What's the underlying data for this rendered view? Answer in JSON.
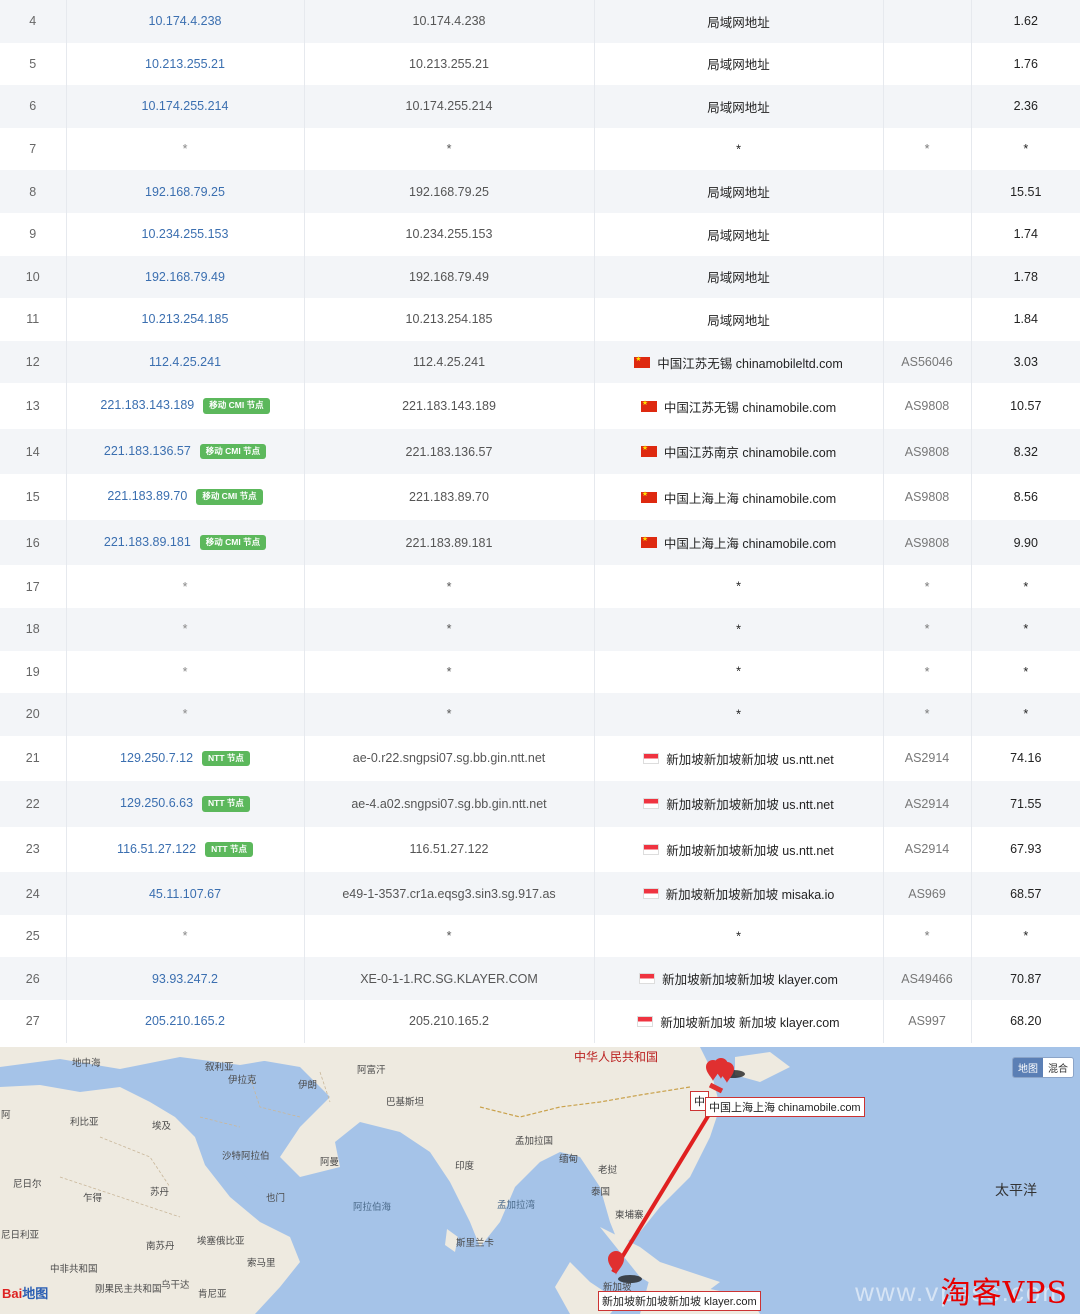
{
  "table": {
    "rows": [
      {
        "hop": "4",
        "ip": "10.174.4.238",
        "badge": "",
        "host": "10.174.4.238",
        "flag": "",
        "geo": "局域网地址",
        "asn": "",
        "rtt": "1.62"
      },
      {
        "hop": "5",
        "ip": "10.213.255.21",
        "badge": "",
        "host": "10.213.255.21",
        "flag": "",
        "geo": "局域网地址",
        "asn": "",
        "rtt": "1.76"
      },
      {
        "hop": "6",
        "ip": "10.174.255.214",
        "badge": "",
        "host": "10.174.255.214",
        "flag": "",
        "geo": "局域网地址",
        "asn": "",
        "rtt": "2.36"
      },
      {
        "hop": "7",
        "ip": "*",
        "badge": "",
        "host": "*",
        "flag": "",
        "geo": "*",
        "asn": "*",
        "rtt": "*"
      },
      {
        "hop": "8",
        "ip": "192.168.79.25",
        "badge": "",
        "host": "192.168.79.25",
        "flag": "",
        "geo": "局域网地址",
        "asn": "",
        "rtt": "15.51"
      },
      {
        "hop": "9",
        "ip": "10.234.255.153",
        "badge": "",
        "host": "10.234.255.153",
        "flag": "",
        "geo": "局域网地址",
        "asn": "",
        "rtt": "1.74"
      },
      {
        "hop": "10",
        "ip": "192.168.79.49",
        "badge": "",
        "host": "192.168.79.49",
        "flag": "",
        "geo": "局域网地址",
        "asn": "",
        "rtt": "1.78"
      },
      {
        "hop": "11",
        "ip": "10.213.254.185",
        "badge": "",
        "host": "10.213.254.185",
        "flag": "",
        "geo": "局域网地址",
        "asn": "",
        "rtt": "1.84"
      },
      {
        "hop": "12",
        "ip": "112.4.25.241",
        "badge": "",
        "host": "112.4.25.241",
        "flag": "cn",
        "geo": "中国江苏无锡 chinamobileltd.com",
        "asn": "AS56046",
        "rtt": "3.03"
      },
      {
        "hop": "13",
        "ip": "221.183.143.189",
        "badge": "移动 CMI 节点",
        "host": "221.183.143.189",
        "flag": "cn",
        "geo": "中国江苏无锡 chinamobile.com",
        "asn": "AS9808",
        "rtt": "10.57"
      },
      {
        "hop": "14",
        "ip": "221.183.136.57",
        "badge": "移动 CMI 节点",
        "host": "221.183.136.57",
        "flag": "cn",
        "geo": "中国江苏南京 chinamobile.com",
        "asn": "AS9808",
        "rtt": "8.32"
      },
      {
        "hop": "15",
        "ip": "221.183.89.70",
        "badge": "移动 CMI 节点",
        "host": "221.183.89.70",
        "flag": "cn",
        "geo": "中国上海上海 chinamobile.com",
        "asn": "AS9808",
        "rtt": "8.56"
      },
      {
        "hop": "16",
        "ip": "221.183.89.181",
        "badge": "移动 CMI 节点",
        "host": "221.183.89.181",
        "flag": "cn",
        "geo": "中国上海上海 chinamobile.com",
        "asn": "AS9808",
        "rtt": "9.90"
      },
      {
        "hop": "17",
        "ip": "*",
        "badge": "",
        "host": "*",
        "flag": "",
        "geo": "*",
        "asn": "*",
        "rtt": "*"
      },
      {
        "hop": "18",
        "ip": "*",
        "badge": "",
        "host": "*",
        "flag": "",
        "geo": "*",
        "asn": "*",
        "rtt": "*"
      },
      {
        "hop": "19",
        "ip": "*",
        "badge": "",
        "host": "*",
        "flag": "",
        "geo": "*",
        "asn": "*",
        "rtt": "*"
      },
      {
        "hop": "20",
        "ip": "*",
        "badge": "",
        "host": "*",
        "flag": "",
        "geo": "*",
        "asn": "*",
        "rtt": "*"
      },
      {
        "hop": "21",
        "ip": "129.250.7.12",
        "badge": "NTT 节点",
        "host": "ae-0.r22.sngpsi07.sg.bb.gin.ntt.net",
        "flag": "sg",
        "geo": "新加坡新加坡新加坡 us.ntt.net",
        "asn": "AS2914",
        "rtt": "74.16"
      },
      {
        "hop": "22",
        "ip": "129.250.6.63",
        "badge": "NTT 节点",
        "host": "ae-4.a02.sngpsi07.sg.bb.gin.ntt.net",
        "flag": "sg",
        "geo": "新加坡新加坡新加坡 us.ntt.net",
        "asn": "AS2914",
        "rtt": "71.55"
      },
      {
        "hop": "23",
        "ip": "116.51.27.122",
        "badge": "NTT 节点",
        "host": "116.51.27.122",
        "flag": "sg",
        "geo": "新加坡新加坡新加坡 us.ntt.net",
        "asn": "AS2914",
        "rtt": "67.93"
      },
      {
        "hop": "24",
        "ip": "45.11.107.67",
        "badge": "",
        "host": "e49-1-3537.cr1a.eqsg3.sin3.sg.917.as",
        "flag": "sg",
        "geo": "新加坡新加坡新加坡 misaka.io",
        "asn": "AS969",
        "rtt": "68.57"
      },
      {
        "hop": "25",
        "ip": "*",
        "badge": "",
        "host": "*",
        "flag": "",
        "geo": "*",
        "asn": "*",
        "rtt": "*"
      },
      {
        "hop": "26",
        "ip": "93.93.247.2",
        "badge": "",
        "host": "XE-0-1-1.RC.SG.KLAYER.COM",
        "flag": "sg",
        "geo": "新加坡新加坡新加坡 klayer.com",
        "asn": "AS49466",
        "rtt": "70.87"
      },
      {
        "hop": "27",
        "ip": "205.210.165.2",
        "badge": "",
        "host": "205.210.165.2",
        "flag": "sg",
        "geo": "新加坡新加坡 新加坡 klayer.com",
        "asn": "AS997",
        "rtt": "68.20"
      }
    ]
  },
  "map": {
    "labels": {
      "china": "中华人民共和国",
      "mediterranean": "地中海",
      "syria": "叙利亚",
      "iraq": "伊拉克",
      "iran": "伊朗",
      "afghanistan": "阿富汗",
      "pakistan": "巴基斯坦",
      "libya": "利比亚",
      "egypt": "埃及",
      "saudi": "沙特阿拉伯",
      "oman": "阿曼",
      "india": "印度",
      "bangladesh": "孟加拉国",
      "myanmar": "缅甸",
      "laos": "老挝",
      "thailand": "泰国",
      "cambodia": "柬埔寨",
      "niger": "尼日尔",
      "chad": "乍得",
      "sudan": "苏丹",
      "yemen": "也门",
      "nigeria": "尼日利亚",
      "south_sudan": "南苏丹",
      "ethiopia": "埃塞俄比亚",
      "somalia": "索马里",
      "car": "中非共和国",
      "drc": "刚果民主共和国",
      "uganda": "乌干达",
      "kenya": "肯尼亚",
      "arabian_sea": "阿拉伯海",
      "bay_of_bengal": "孟加拉湾",
      "sri_lanka": "斯里兰卡",
      "pacific": "太平洋",
      "singapore": "新加坡",
      "west_edge": "阿"
    },
    "toggle": {
      "map": "地图",
      "hybrid": "混合"
    },
    "tooltip_shanghai": "中国上海上海 chinamobile.com",
    "tooltip_singapore": "新加坡新加坡新加坡 klayer.com",
    "tooltip_stub": "中",
    "logo_left": "Bai",
    "logo_right": "地图"
  },
  "watermark": {
    "text": "淘客VPS",
    "url": "www.vpsss.com"
  },
  "colors": {
    "row_alt": "#f3f5f8",
    "ip_link": "#3b6fb0",
    "badge": "#5cb85c",
    "route_line": "#e02020",
    "marker": "#e03030",
    "watermark": "#e60000"
  }
}
